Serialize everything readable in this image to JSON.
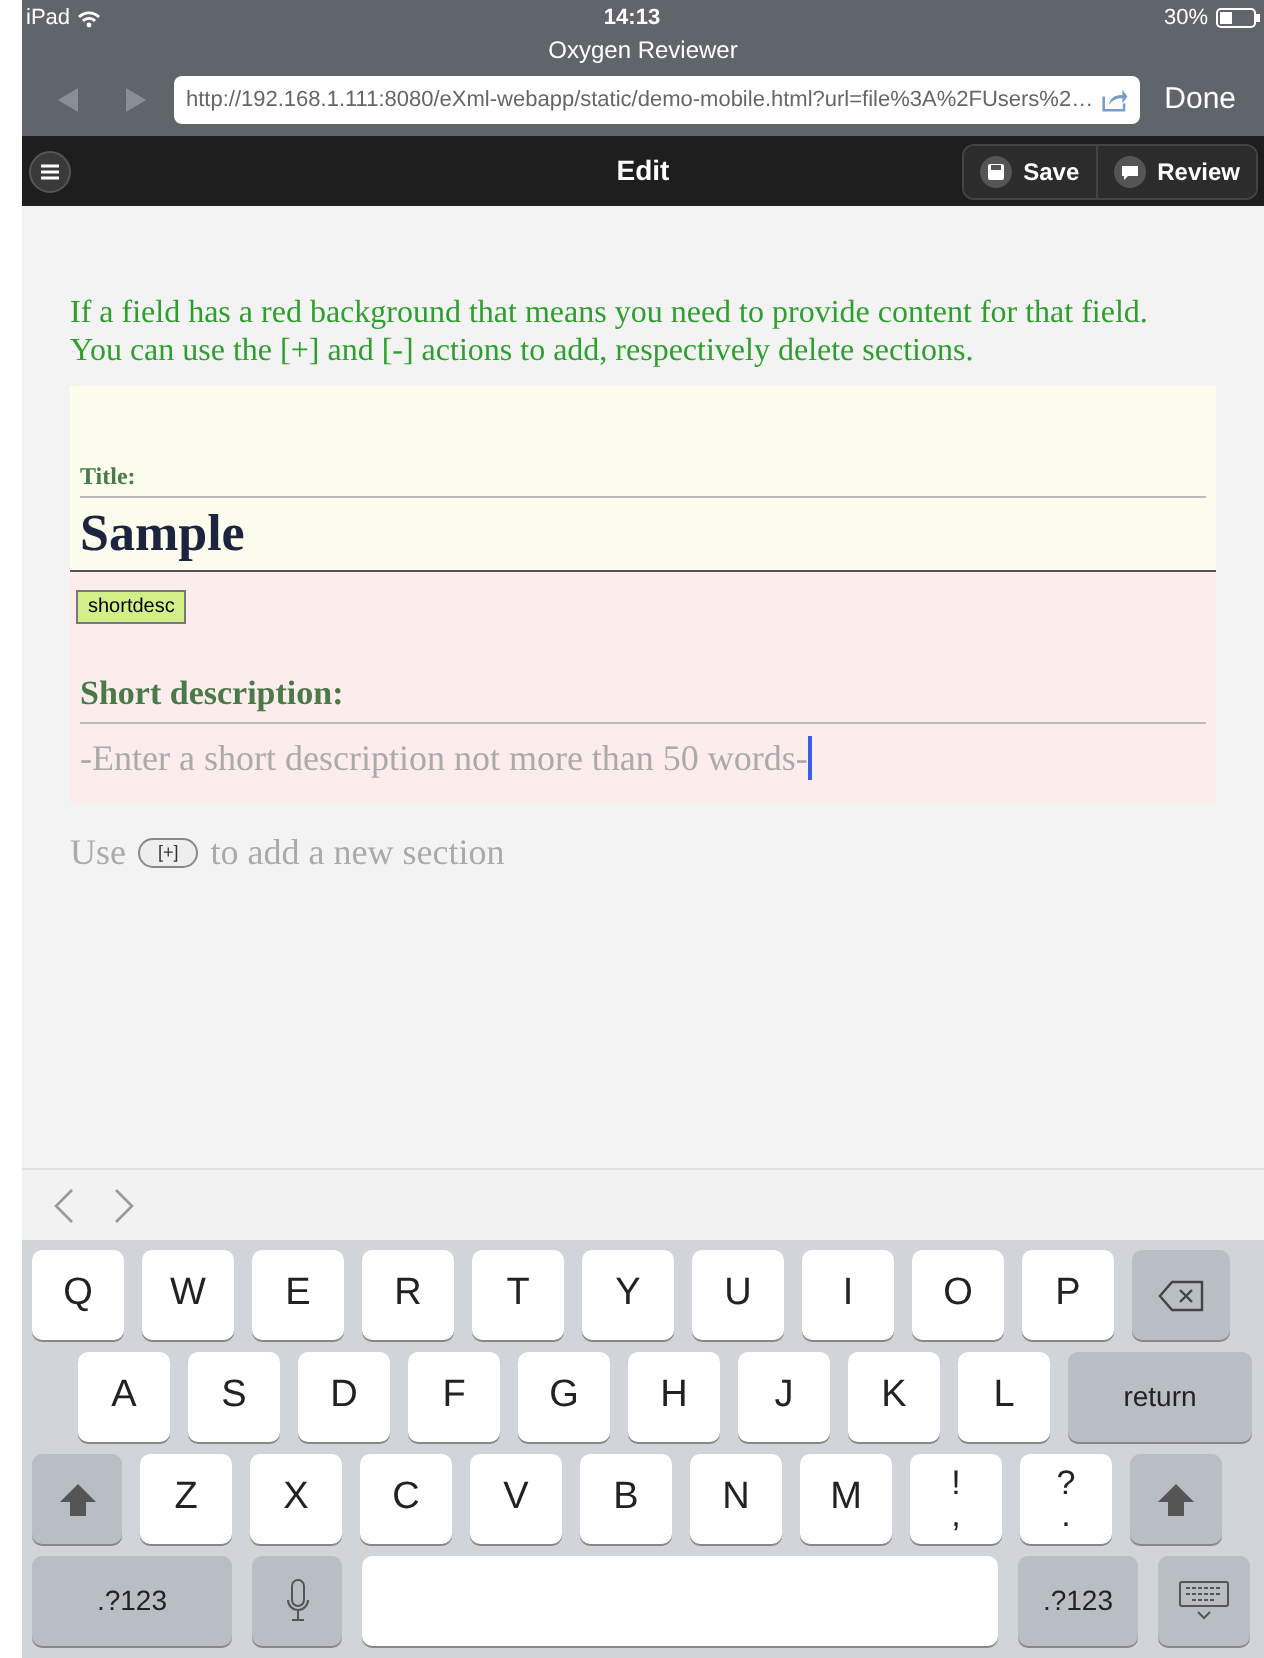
{
  "status_bar": {
    "device": "iPad",
    "time": "14:13",
    "battery": "30%"
  },
  "browser": {
    "title": "Oxygen Reviewer",
    "url": "http://192.168.1.111:8080/eXml-webapp/static/demo-mobile.html?url=file%3A%2FUsers%2…",
    "done": "Done"
  },
  "toolbar": {
    "title": "Edit",
    "buttons": [
      {
        "label": "Save",
        "kind": "save"
      },
      {
        "label": "Review",
        "kind": "review"
      }
    ]
  },
  "instructions": [
    "If a field has a red background that means you need to provide content for that field.",
    "You can use the [+] and [-] actions to add, respectively delete sections."
  ],
  "form": {
    "title_label": "Title:",
    "title_value": "Sample",
    "tag": "shortdesc",
    "short_label": "Short description:",
    "short_placeholder": "-Enter a short description not more than 50 words-",
    "focused": true
  },
  "hint": {
    "before": "Use",
    "button": "[+]",
    "after": "to add a new section"
  },
  "keyboard": [
    [
      {
        "kind": "char",
        "label": "Q"
      },
      {
        "kind": "char",
        "label": "W"
      },
      {
        "kind": "char",
        "label": "E"
      },
      {
        "kind": "char",
        "label": "R"
      },
      {
        "kind": "char",
        "label": "T"
      },
      {
        "kind": "char",
        "label": "Y"
      },
      {
        "kind": "char",
        "label": "U"
      },
      {
        "kind": "char",
        "label": "I"
      },
      {
        "kind": "char",
        "label": "O"
      },
      {
        "kind": "char",
        "label": "P"
      },
      {
        "kind": "backspace"
      }
    ],
    [
      {
        "kind": "char",
        "label": "A"
      },
      {
        "kind": "char",
        "label": "S"
      },
      {
        "kind": "char",
        "label": "D"
      },
      {
        "kind": "char",
        "label": "F"
      },
      {
        "kind": "char",
        "label": "G"
      },
      {
        "kind": "char",
        "label": "H"
      },
      {
        "kind": "char",
        "label": "J"
      },
      {
        "kind": "char",
        "label": "K"
      },
      {
        "kind": "char",
        "label": "L"
      },
      {
        "kind": "special",
        "label": "return"
      }
    ],
    [
      {
        "kind": "shift"
      },
      {
        "kind": "char",
        "label": "Z"
      },
      {
        "kind": "char",
        "label": "X"
      },
      {
        "kind": "char",
        "label": "C"
      },
      {
        "kind": "char",
        "label": "V"
      },
      {
        "kind": "char",
        "label": "B"
      },
      {
        "kind": "char",
        "label": "N"
      },
      {
        "kind": "char",
        "label": "M"
      },
      {
        "kind": "dual",
        "label": "!",
        "sublabel": ","
      },
      {
        "kind": "dual",
        "label": "?",
        "sublabel": "."
      },
      {
        "kind": "shift"
      }
    ],
    [
      {
        "kind": "special",
        "label": ".?123"
      },
      {
        "kind": "mic"
      },
      {
        "kind": "space"
      },
      {
        "kind": "special",
        "label": ".?123"
      },
      {
        "kind": "hide"
      }
    ]
  ]
}
